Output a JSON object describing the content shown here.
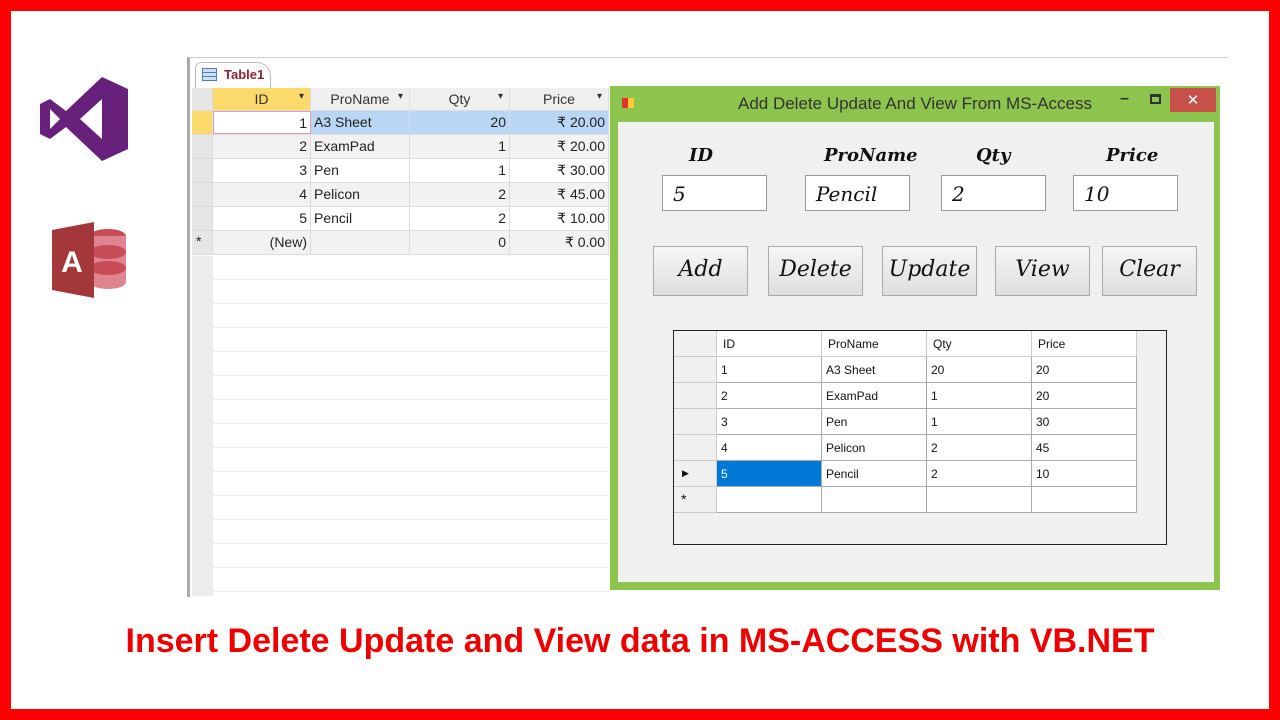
{
  "access": {
    "tab": "Table1",
    "columns": [
      "ID",
      "ProName",
      "Qty",
      "Price"
    ],
    "rows": [
      [
        "1",
        "A3 Sheet",
        "20",
        "₹ 20.00"
      ],
      [
        "2",
        "ExamPad",
        "1",
        "₹ 20.00"
      ],
      [
        "3",
        "Pen",
        "1",
        "₹ 30.00"
      ],
      [
        "4",
        "Pelicon",
        "2",
        "₹ 45.00"
      ],
      [
        "5",
        "Pencil",
        "2",
        "₹ 10.00"
      ]
    ],
    "new_row": [
      "(New)",
      "",
      "0",
      "₹ 0.00"
    ],
    "new_marker": "*"
  },
  "form": {
    "title": "Add Delete Update And View From MS-Access",
    "labels": {
      "id": "ID",
      "proname": "ProName",
      "qty": "Qty",
      "price": "Price"
    },
    "values": {
      "id": "5",
      "proname": "Pencil",
      "qty": "2",
      "price": "10"
    },
    "buttons": {
      "add": "Add",
      "delete": "Delete",
      "update": "Update",
      "view": "View",
      "clear": "Clear"
    },
    "grid": {
      "columns": [
        "ID",
        "ProName",
        "Qty",
        "Price"
      ],
      "rows": [
        [
          "1",
          "A3 Sheet",
          "20",
          "20"
        ],
        [
          "2",
          "ExamPad",
          "1",
          "20"
        ],
        [
          "3",
          "Pen",
          "1",
          "30"
        ],
        [
          "4",
          "Pelicon",
          "2",
          "45"
        ],
        [
          "5",
          "Pencil",
          "2",
          "10"
        ]
      ],
      "current_marker": "▶",
      "new_marker": "*"
    }
  },
  "caption": "Insert Delete Update and View data in MS-ACCESS with VB.NET",
  "colors": {
    "border": "#ff0000",
    "window_frame": "#8dc44d",
    "caption": "#ee0000",
    "vs": "#68217a",
    "access": "#a4373a"
  }
}
